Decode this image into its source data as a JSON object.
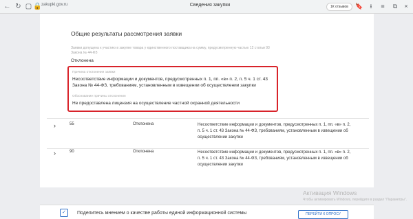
{
  "browser": {
    "url": "zakupki.gov.ru",
    "tab_title": "Сведения закупки",
    "reviews_badge": "1К отзывов"
  },
  "section": {
    "title": "Общие результаты рассмотрения заявки",
    "note": "Заявки допущена к участию в закупке товара у единственного поставщика на сумму, предусмотренную частью 12 статьи 93 Закона № 44-ФЗ",
    "status": "Отклонена"
  },
  "highlight": {
    "reason_label": "Причина отклонения заявки",
    "reason_text": "Несоответствие информации и документов, предусмотренных п. 1, пп. «в» п. 2, п. 5 ч. 1 ст. 43 Закона № 44-ФЗ, требованиям, установленным в извещении об осуществлении закупки",
    "justification_label": "Обоснование причины отклонения",
    "justification_text": "Не предоставлена лицензия на осуществление частной охранной деятельности"
  },
  "rows": [
    {
      "number": "55",
      "status": "Отклонена",
      "reason": "Несоответствие информации и документов, предусмотренных п. 1, пп. «в» п. 2, п. 5 ч. 1 ст. 43 Закона № 44-ФЗ, требованиям, установленным в извещении об осуществлении закупки"
    },
    {
      "number": "90",
      "status": "Отклонена",
      "reason": "Несоответствие информации и документов, предусмотренных п. 1, пп. «в» п. 2, п. 5 ч. 1 ст. 43 Закона № 44-ФЗ, требованиям, установленным в извещении об осуществлении закупки"
    }
  ],
  "windows_watermark": {
    "line1": "Активация Windows",
    "line2": "Чтобы активировать Windows, перейдите в раздел \"Параметры\"."
  },
  "feedback": {
    "text": "Поделитесь мнением о качестве работы единой информационной системы",
    "button": "ПЕРЕЙТИ К ОПРОСУ"
  },
  "colors": {
    "highlight_border": "#d8232a",
    "accent_blue": "#2c6ec7"
  }
}
